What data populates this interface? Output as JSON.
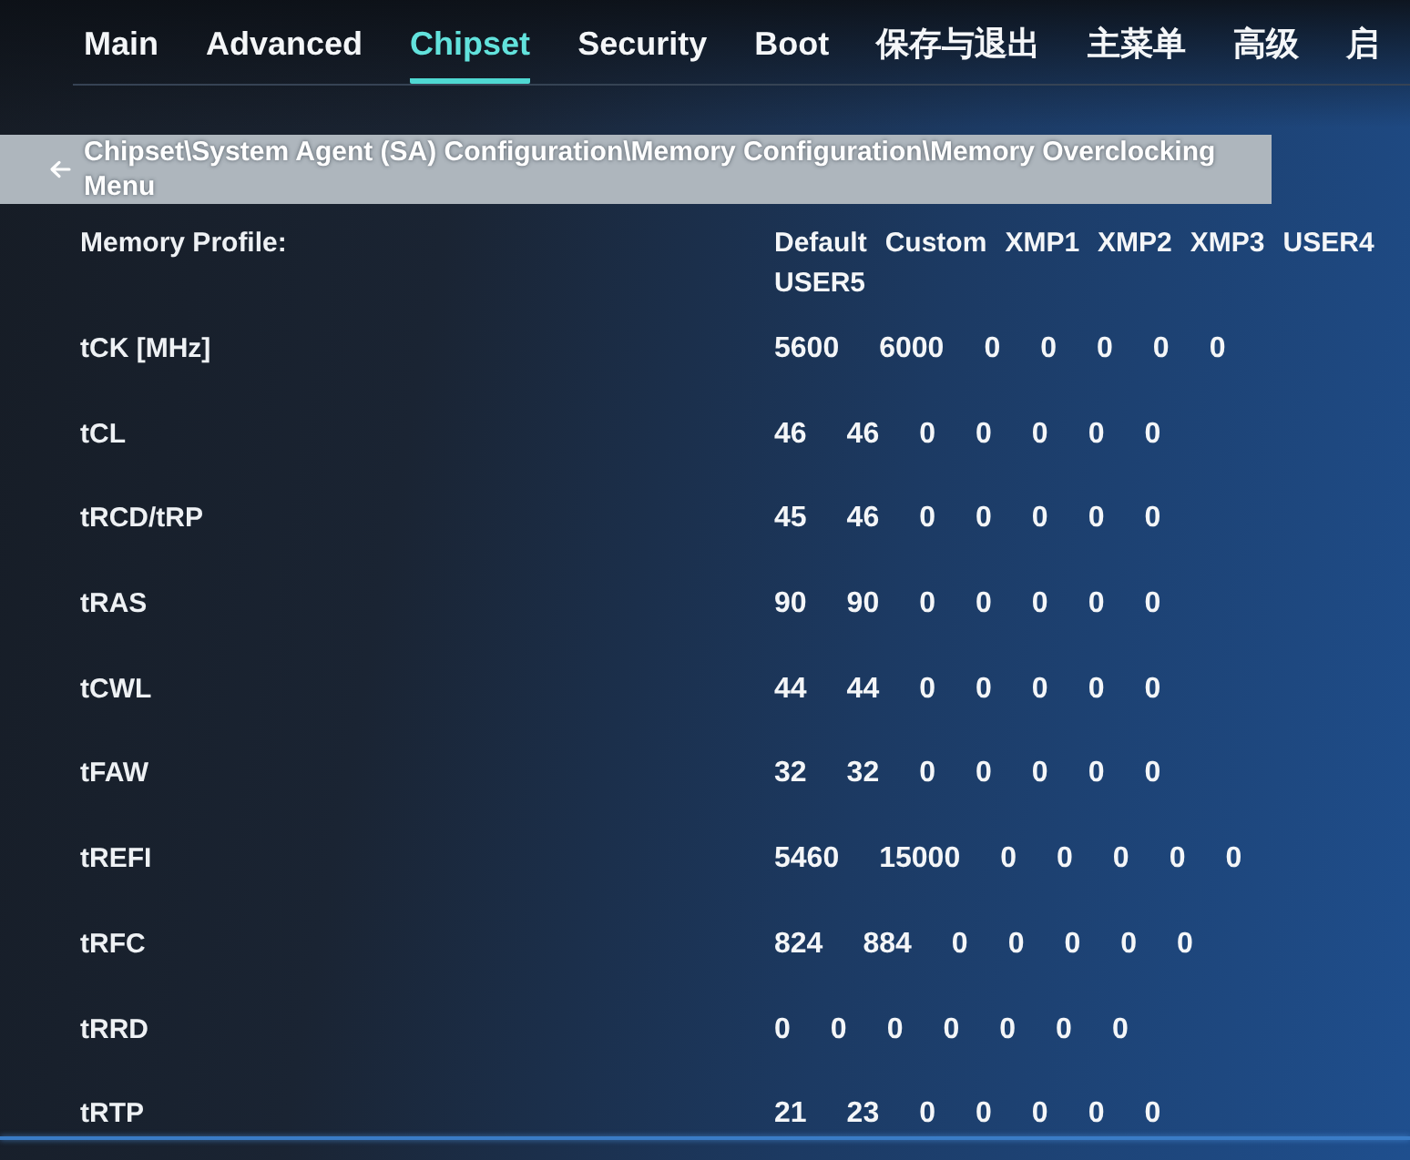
{
  "tabs": [
    {
      "label": "Main",
      "selected": false
    },
    {
      "label": "Advanced",
      "selected": false
    },
    {
      "label": "Chipset",
      "selected": true
    },
    {
      "label": "Security",
      "selected": false
    },
    {
      "label": "Boot",
      "selected": false
    },
    {
      "label": "保存与退出",
      "selected": false
    },
    {
      "label": "主菜单",
      "selected": false
    },
    {
      "label": "高级",
      "selected": false
    },
    {
      "label": "启",
      "selected": false
    }
  ],
  "breadcrumb": {
    "path": "Chipset\\System Agent (SA) Configuration\\Memory Configuration\\Memory Overclocking Menu"
  },
  "profile_header": {
    "label": "Memory Profile:",
    "columns": [
      "Default",
      "Custom",
      "XMP1",
      "XMP2",
      "XMP3",
      "USER4",
      "USER5"
    ]
  },
  "rows": [
    {
      "label": "tCK [MHz]",
      "values": [
        "5600",
        "6000",
        "0",
        "0",
        "0",
        "0",
        "0"
      ]
    },
    {
      "label": "tCL",
      "values": [
        "46",
        "46",
        "0",
        "0",
        "0",
        "0",
        "0"
      ]
    },
    {
      "label": "tRCD/tRP",
      "values": [
        "45",
        "46",
        "0",
        "0",
        "0",
        "0",
        "0"
      ]
    },
    {
      "label": "tRAS",
      "values": [
        "90",
        "90",
        "0",
        "0",
        "0",
        "0",
        "0"
      ]
    },
    {
      "label": "tCWL",
      "values": [
        "44",
        "44",
        "0",
        "0",
        "0",
        "0",
        "0"
      ]
    },
    {
      "label": "tFAW",
      "values": [
        "32",
        "32",
        "0",
        "0",
        "0",
        "0",
        "0"
      ]
    },
    {
      "label": "tREFI",
      "values": [
        "5460",
        "15000",
        "0",
        "0",
        "0",
        "0",
        "0"
      ]
    },
    {
      "label": "tRFC",
      "values": [
        "824",
        "884",
        "0",
        "0",
        "0",
        "0",
        "0"
      ]
    },
    {
      "label": "tRRD",
      "values": [
        "0",
        "0",
        "0",
        "0",
        "0",
        "0",
        "0"
      ]
    },
    {
      "label": "tRTP",
      "values": [
        "21",
        "23",
        "0",
        "0",
        "0",
        "0",
        "0"
      ]
    }
  ]
}
